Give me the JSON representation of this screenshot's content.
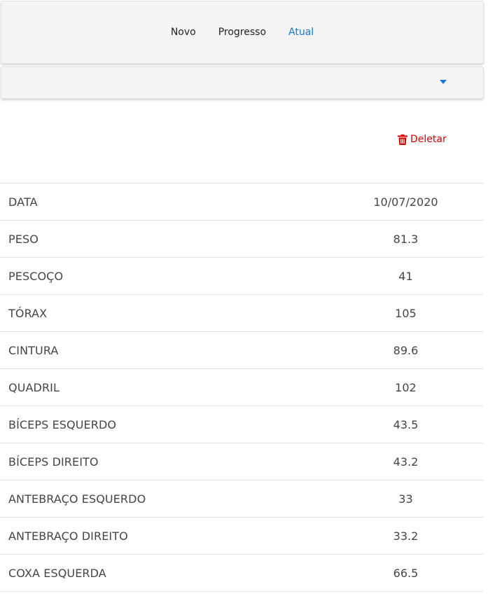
{
  "nav": {
    "tabs": [
      {
        "label": "Novo",
        "active": false
      },
      {
        "label": "Progresso",
        "active": false
      },
      {
        "label": "Atual",
        "active": true
      }
    ]
  },
  "select": {
    "value": "",
    "caret_icon": "caret-down-icon"
  },
  "actions": {
    "delete_label": "Deletar",
    "delete_icon": "trash-icon",
    "delete_color": "#d50000"
  },
  "colors": {
    "accent": "#1976d2",
    "danger": "#d50000"
  },
  "measurements": [
    {
      "label": "DATA",
      "value": "10/07/2020"
    },
    {
      "label": "PESO",
      "value": "81.3"
    },
    {
      "label": "PESCOÇO",
      "value": "41"
    },
    {
      "label": "TÓRAX",
      "value": "105"
    },
    {
      "label": "CINTURA",
      "value": "89.6"
    },
    {
      "label": "QUADRIL",
      "value": "102"
    },
    {
      "label": "BÍCEPS ESQUERDO",
      "value": "43.5"
    },
    {
      "label": "BÍCEPS DIREITO",
      "value": "43.2"
    },
    {
      "label": "ANTEBRAÇO ESQUERDO",
      "value": "33"
    },
    {
      "label": "ANTEBRAÇO DIREITO",
      "value": "33.2"
    },
    {
      "label": "COXA ESQUERDA",
      "value": "66.5"
    }
  ]
}
